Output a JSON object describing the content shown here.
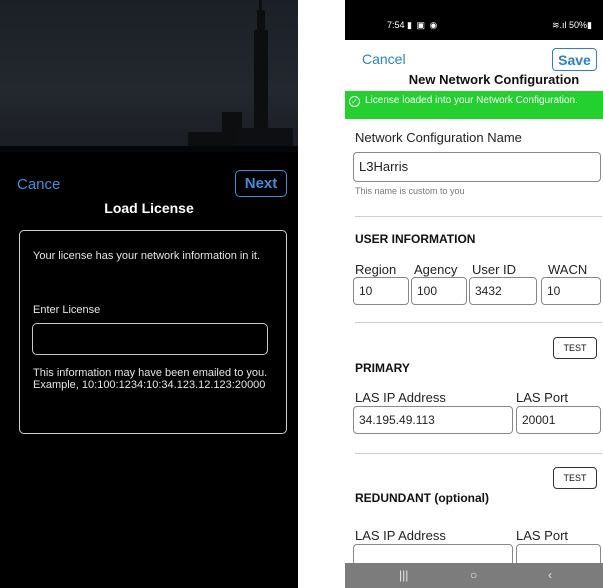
{
  "left": {
    "cancel_label": "Cance",
    "next_label": "Next",
    "title": "Load License",
    "card_description": "Your license has your network information in it.",
    "enter_license_label": "Enter License",
    "license_value": "",
    "hint_text": "This information may have been emailed to you. Example, 10:100:1234:10:34.123.12.123:20000"
  },
  "right": {
    "status": {
      "time": "7:54",
      "icons": "▮ ▣ ◉",
      "right": "≋.ıl 50%▮"
    },
    "cancel_label": "Cancel",
    "save_label": "Save",
    "title": "New Network Configuration",
    "banner_text": "License loaded into your Network Configuration.",
    "banner_icon": "✓",
    "colors": {
      "accent": "#2a7fd4",
      "success": "#22d12e"
    },
    "config_name": {
      "label": "Network Configuration Name",
      "value": "L3Harris",
      "helper": "This name is custom to you"
    },
    "user_info": {
      "heading": "USER INFORMATION",
      "region": {
        "label": "Region",
        "value": "10"
      },
      "agency": {
        "label": "Agency",
        "value": "100"
      },
      "user_id": {
        "label": "User ID",
        "value": "3432"
      },
      "wacn": {
        "label": "WACN",
        "value": "10"
      }
    },
    "primary": {
      "heading": "PRIMARY",
      "test_label": "TEST",
      "ip_label": "LAS IP Address",
      "ip_value": "34.195.49.113",
      "port_label": "LAS Port",
      "port_value": "20001"
    },
    "redundant": {
      "heading": "REDUNDANT (optional)",
      "test_label": "TEST",
      "ip_label": "LAS IP Address",
      "ip_value": "",
      "port_label": "LAS Port",
      "port_value": ""
    },
    "nav": {
      "recents": "|||",
      "home": "○",
      "back": "‹"
    }
  }
}
